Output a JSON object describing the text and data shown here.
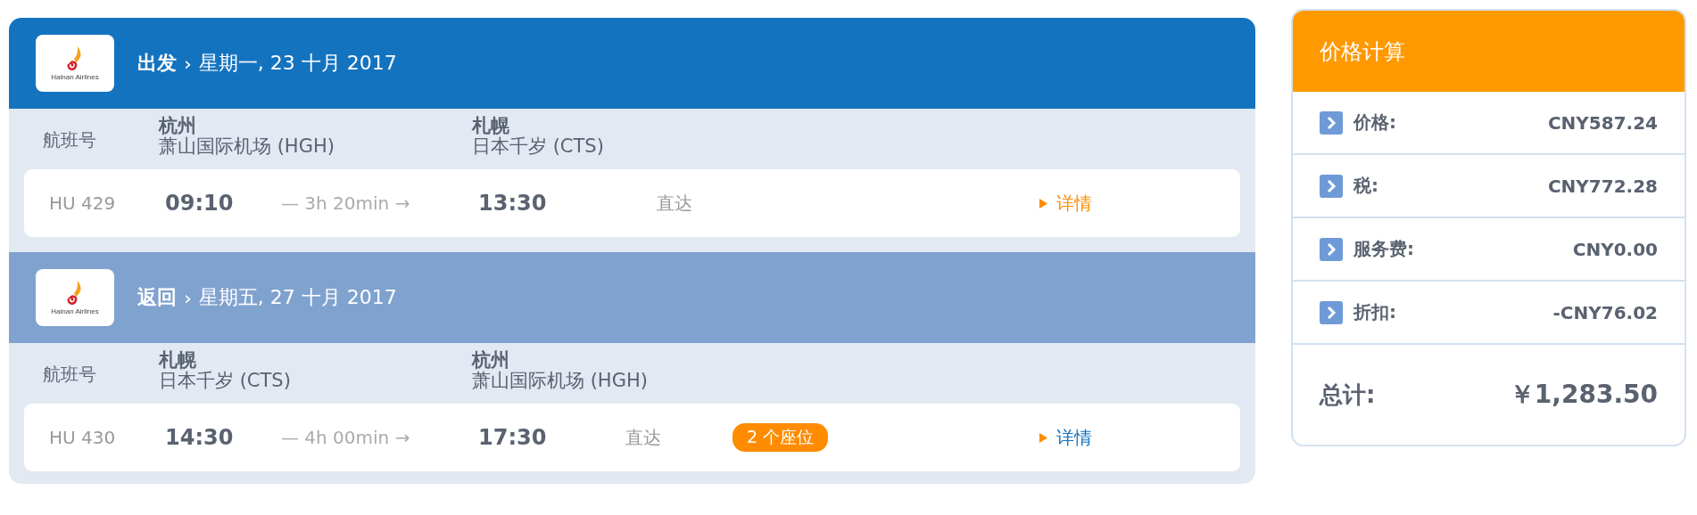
{
  "legs": [
    {
      "active": true,
      "logo_text": "Hainan Airlines",
      "direction": "出发",
      "separator": "›",
      "date": "星期一, 23 十月 2017",
      "flight_number_label": "航班号",
      "origin_city": "杭州",
      "origin_airport": "萧山国际机场 (HGH)",
      "destination_city": "札幌",
      "destination_airport": "日本千岁 (CTS)",
      "flight_number": "HU 429",
      "departure_time": "09:10",
      "duration": "— 3h 20min →",
      "arrival_time": "13:30",
      "stops": "直达",
      "details": {
        "label": "详情",
        "highlighted": true
      }
    },
    {
      "active": false,
      "logo_text": "Hainan Airlines",
      "direction": "返回",
      "separator": "›",
      "date": "星期五, 27 十月 2017",
      "flight_number_label": "航班号",
      "origin_city": "札幌",
      "origin_airport": "日本千岁 (CTS)",
      "destination_city": "杭州",
      "destination_airport": "萧山国际机场 (HGH)",
      "flight_number": "HU 430",
      "departure_time": "14:30",
      "duration": "— 4h 00min →",
      "arrival_time": "17:30",
      "stops": "直达",
      "seats": "2 个座位",
      "details": {
        "label": "详情",
        "highlighted": false
      }
    }
  ],
  "price": {
    "title": "价格计算",
    "items": [
      {
        "label": "价格:",
        "value": "CNY587.24"
      },
      {
        "label": "税:",
        "value": "CNY772.28"
      },
      {
        "label": "服务费:",
        "value": "CNY0.00"
      },
      {
        "label": "折扣:",
        "value": "-CNY76.02"
      }
    ],
    "total_label": "总计:",
    "total_value": "￥1,283.50"
  }
}
